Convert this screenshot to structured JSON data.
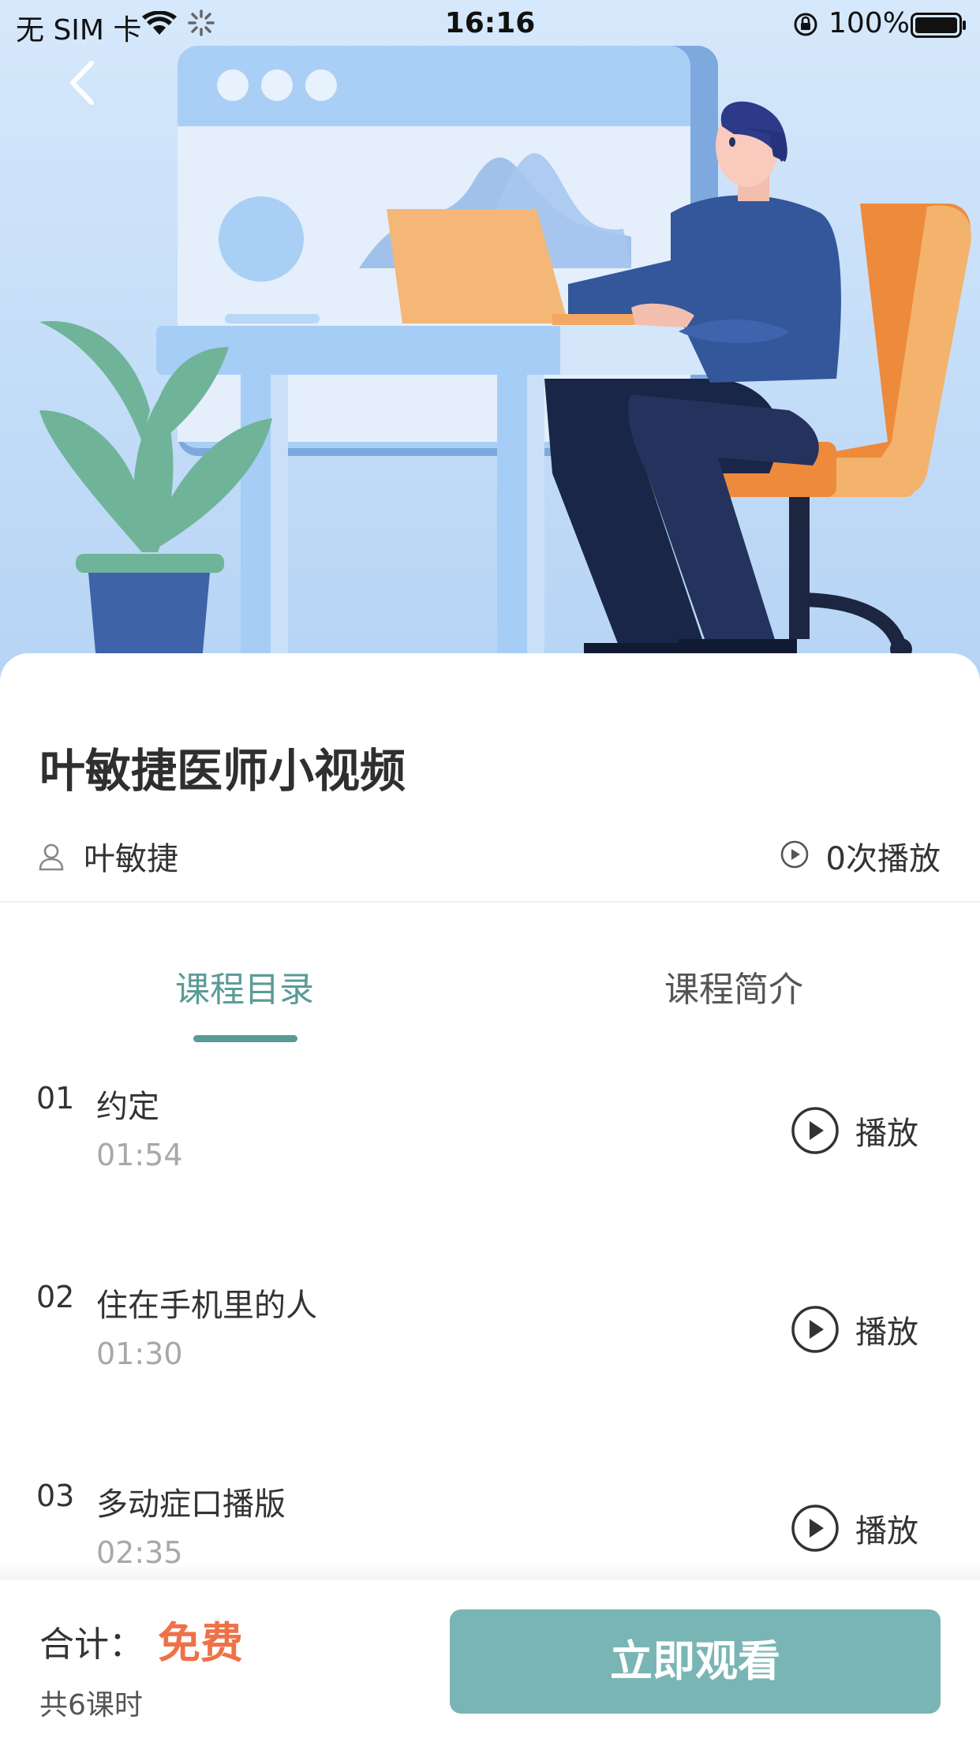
{
  "status_bar": {
    "carrier": "无 SIM 卡",
    "time": "16:16",
    "battery": "100%"
  },
  "course": {
    "title": "叶敏捷医师小视频",
    "author": "叶敏捷",
    "plays": "0次播放"
  },
  "tabs": [
    {
      "label": "课程目录",
      "active": true
    },
    {
      "label": "课程简介",
      "active": false
    }
  ],
  "lessons": [
    {
      "num": "01",
      "name": "约定",
      "duration": "01:54",
      "play_label": "播放"
    },
    {
      "num": "02",
      "name": "住在手机里的人",
      "duration": "01:30",
      "play_label": "播放"
    },
    {
      "num": "03",
      "name": "多动症口播版",
      "duration": "02:35",
      "play_label": "播放"
    }
  ],
  "footer": {
    "total_label": "合计：",
    "price": "免费",
    "lesson_count": "共6课时",
    "watch_button": "立即观看"
  },
  "colors": {
    "accent": "#5a9b96",
    "button": "#7ab5b5",
    "price": "#ef7148"
  }
}
